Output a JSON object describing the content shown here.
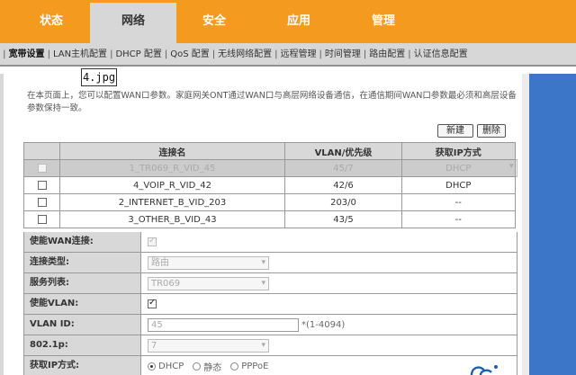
{
  "topnav": {
    "tabs": [
      {
        "label": "状态",
        "active": false
      },
      {
        "label": "网络",
        "active": true
      },
      {
        "label": "安全",
        "active": false
      },
      {
        "label": "应用",
        "active": false
      },
      {
        "label": "管理",
        "active": false
      }
    ]
  },
  "subnav": {
    "items": [
      "宽带设置",
      "LAN主机配置",
      "DHCP 配置",
      "QoS 配置",
      "无线网络配置",
      "远程管理",
      "时间管理",
      "路由配置",
      "认证信息配置"
    ]
  },
  "image_tag": "4.jpg",
  "description": "在本页面上，您可以配置WAN口参数。家庭网关ONT通过WAN口与高层网络设备通信，在通信期间WAN口参数最必须和高层设备参数保持一致。",
  "buttons": {
    "new": "新建",
    "delete": "删除"
  },
  "table": {
    "headers": [
      "",
      "连接名",
      "VLAN/优先级",
      "获取IP方式"
    ],
    "rows": [
      {
        "name": "1_TR069_R_VID_45",
        "vlan": "45/7",
        "ip": "DHCP"
      },
      {
        "name": "4_VOIP_R_VID_42",
        "vlan": "42/6",
        "ip": "DHCP"
      },
      {
        "name": "2_INTERNET_B_VID_203",
        "vlan": "203/0",
        "ip": "--"
      },
      {
        "name": "3_OTHER_B_VID_43",
        "vlan": "43/5",
        "ip": "--"
      }
    ]
  },
  "form": {
    "enable_wan_label": "使能WAN连接:",
    "conn_type_label": "连接类型:",
    "conn_type_value": "路由",
    "service_label": "服务列表:",
    "service_value": "TR069",
    "enable_vlan_label": "使能VLAN:",
    "vlan_id_label": "VLAN ID:",
    "vlan_id_value": "45",
    "vlan_id_hint": "*(1-4094)",
    "p8021_label": "802.1p:",
    "p8021_value": "7",
    "ip_mode_label": "获取IP方式:",
    "ip_options": [
      "DHCP",
      "静态",
      "PPPoE"
    ]
  }
}
